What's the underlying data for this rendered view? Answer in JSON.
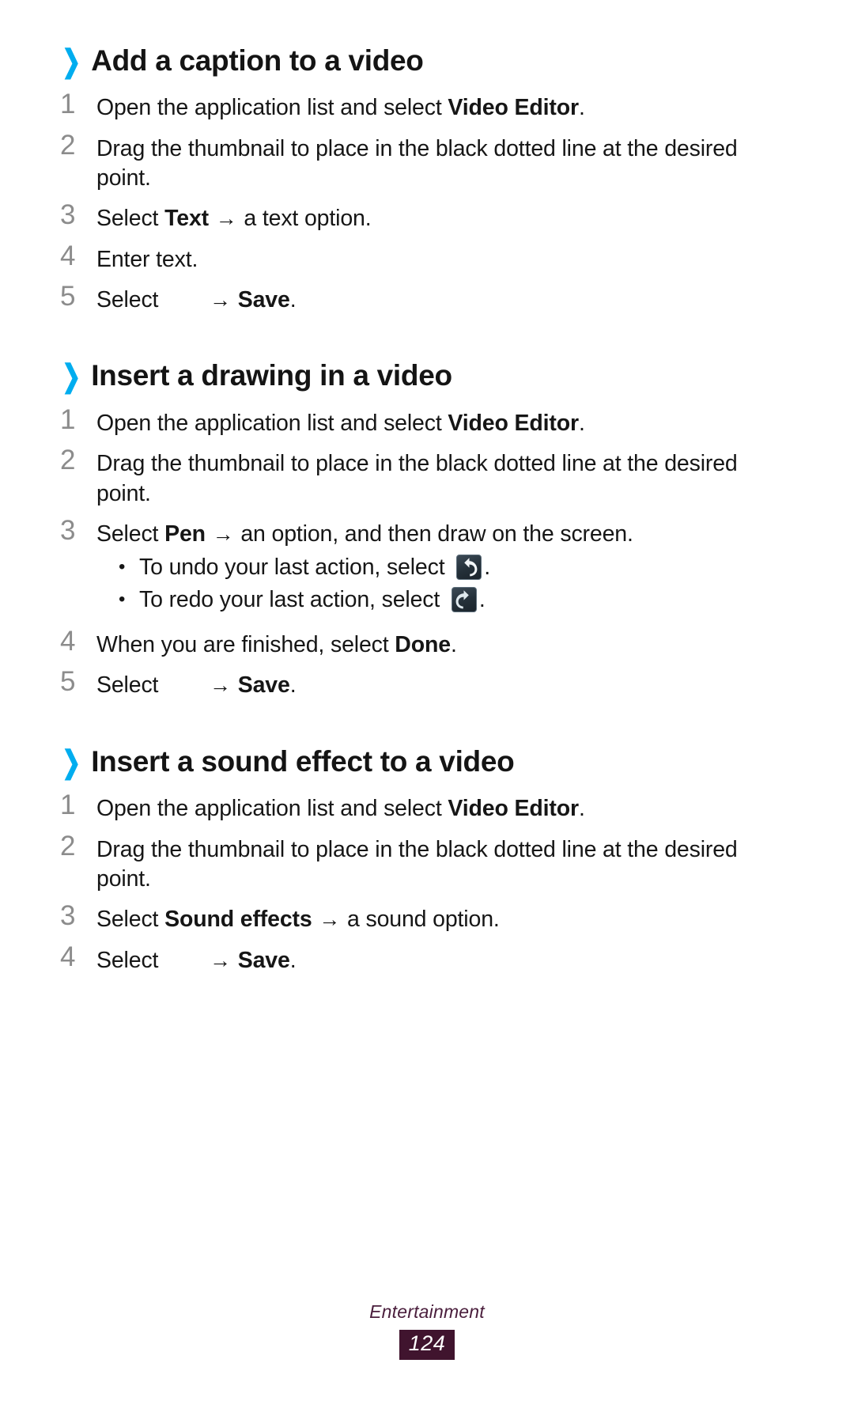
{
  "page": {
    "footer_section": "Entertainment",
    "page_number": "124",
    "accent_color": "#00ADEF",
    "footer_color": "#40142e",
    "step_number_color": "#8c8c8c"
  },
  "sections": [
    {
      "heading": "Add a caption to a video",
      "chevron": "chevron-right-icon",
      "steps": [
        {
          "num": "1",
          "parts": [
            {
              "t": "text",
              "v": "Open the application list and select "
            },
            {
              "t": "bold",
              "v": "Video Editor"
            },
            {
              "t": "text",
              "v": "."
            }
          ]
        },
        {
          "num": "2",
          "parts": [
            {
              "t": "text",
              "v": "Drag the thumbnail to place in the black dotted line at the desired point."
            }
          ]
        },
        {
          "num": "3",
          "parts": [
            {
              "t": "text",
              "v": "Select "
            },
            {
              "t": "bold",
              "v": "Text"
            },
            {
              "t": "text",
              "v": " "
            },
            {
              "t": "arrow",
              "v": "→"
            },
            {
              "t": "text",
              "v": " a text option."
            }
          ]
        },
        {
          "num": "4",
          "parts": [
            {
              "t": "text",
              "v": "Enter text."
            }
          ]
        },
        {
          "num": "5",
          "parts": [
            {
              "t": "text",
              "v": "Select "
            },
            {
              "t": "blank",
              "v": ""
            },
            {
              "t": "arrow",
              "v": "→"
            },
            {
              "t": "text",
              "v": " "
            },
            {
              "t": "bold",
              "v": "Save"
            },
            {
              "t": "text",
              "v": "."
            }
          ]
        }
      ]
    },
    {
      "heading": "Insert a drawing in a video",
      "chevron": "chevron-right-icon",
      "steps": [
        {
          "num": "1",
          "parts": [
            {
              "t": "text",
              "v": "Open the application list and select "
            },
            {
              "t": "bold",
              "v": "Video Editor"
            },
            {
              "t": "text",
              "v": "."
            }
          ]
        },
        {
          "num": "2",
          "parts": [
            {
              "t": "text",
              "v": "Drag the thumbnail to place in the black dotted line at the desired point."
            }
          ]
        },
        {
          "num": "3",
          "parts": [
            {
              "t": "text",
              "v": "Select "
            },
            {
              "t": "bold",
              "v": "Pen"
            },
            {
              "t": "text",
              "v": " "
            },
            {
              "t": "arrow",
              "v": "→"
            },
            {
              "t": "text",
              "v": " an option, and then draw on the screen."
            }
          ],
          "bullets": [
            {
              "parts": [
                {
                  "t": "text",
                  "v": "To undo your last action, select "
                },
                {
                  "t": "icon",
                  "v": "undo-icon"
                },
                {
                  "t": "text",
                  "v": "."
                }
              ]
            },
            {
              "parts": [
                {
                  "t": "text",
                  "v": "To redo your last action, select "
                },
                {
                  "t": "icon",
                  "v": "redo-icon"
                },
                {
                  "t": "text",
                  "v": "."
                }
              ]
            }
          ]
        },
        {
          "num": "4",
          "parts": [
            {
              "t": "text",
              "v": "When you are finished, select "
            },
            {
              "t": "bold",
              "v": "Done"
            },
            {
              "t": "text",
              "v": "."
            }
          ]
        },
        {
          "num": "5",
          "parts": [
            {
              "t": "text",
              "v": "Select "
            },
            {
              "t": "blank",
              "v": ""
            },
            {
              "t": "arrow",
              "v": "→"
            },
            {
              "t": "text",
              "v": " "
            },
            {
              "t": "bold",
              "v": "Save"
            },
            {
              "t": "text",
              "v": "."
            }
          ]
        }
      ]
    },
    {
      "heading": "Insert a sound effect to a video",
      "chevron": "chevron-right-icon",
      "steps": [
        {
          "num": "1",
          "parts": [
            {
              "t": "text",
              "v": "Open the application list and select "
            },
            {
              "t": "bold",
              "v": "Video Editor"
            },
            {
              "t": "text",
              "v": "."
            }
          ]
        },
        {
          "num": "2",
          "parts": [
            {
              "t": "text",
              "v": "Drag the thumbnail to place in the black dotted line at the desired point."
            }
          ]
        },
        {
          "num": "3",
          "parts": [
            {
              "t": "text",
              "v": "Select "
            },
            {
              "t": "bold",
              "v": "Sound effects"
            },
            {
              "t": "text",
              "v": " "
            },
            {
              "t": "arrow",
              "v": "→"
            },
            {
              "t": "text",
              "v": " a sound option."
            }
          ]
        },
        {
          "num": "4",
          "parts": [
            {
              "t": "text",
              "v": "Select "
            },
            {
              "t": "blank",
              "v": ""
            },
            {
              "t": "arrow",
              "v": "→"
            },
            {
              "t": "text",
              "v": " "
            },
            {
              "t": "bold",
              "v": "Save"
            },
            {
              "t": "text",
              "v": "."
            }
          ]
        }
      ]
    }
  ]
}
